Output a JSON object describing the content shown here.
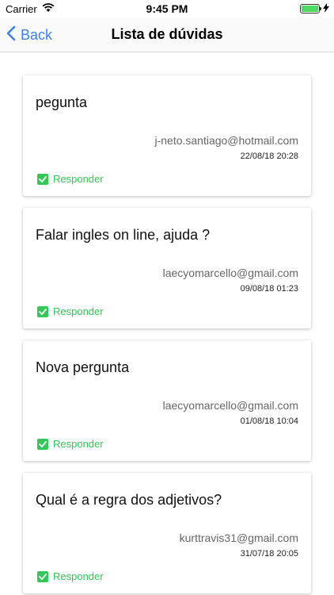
{
  "status_bar": {
    "carrier": "Carrier",
    "time": "9:45 PM"
  },
  "nav": {
    "back_label": "Back",
    "title": "Lista de dúvidas"
  },
  "questions": [
    {
      "title": "pegunta",
      "email": "j-neto.santiago@hotmail.com",
      "date": "22/08/18 20:28",
      "action": "Responder"
    },
    {
      "title": "Falar ingles on line, ajuda ?",
      "email": "laecyomarcello@gmail.com",
      "date": "09/08/18 01:23",
      "action": "Responder"
    },
    {
      "title": "Nova pergunta",
      "email": "laecyomarcello@gmail.com",
      "date": "01/08/18 10:04",
      "action": "Responder"
    },
    {
      "title": "Qual é a regra dos adjetivos?",
      "email": "kurttravis31@gmail.com",
      "date": "31/07/18 20:05",
      "action": "Responder"
    }
  ],
  "colors": {
    "accent": "#3b82f6",
    "success": "#34c759"
  }
}
